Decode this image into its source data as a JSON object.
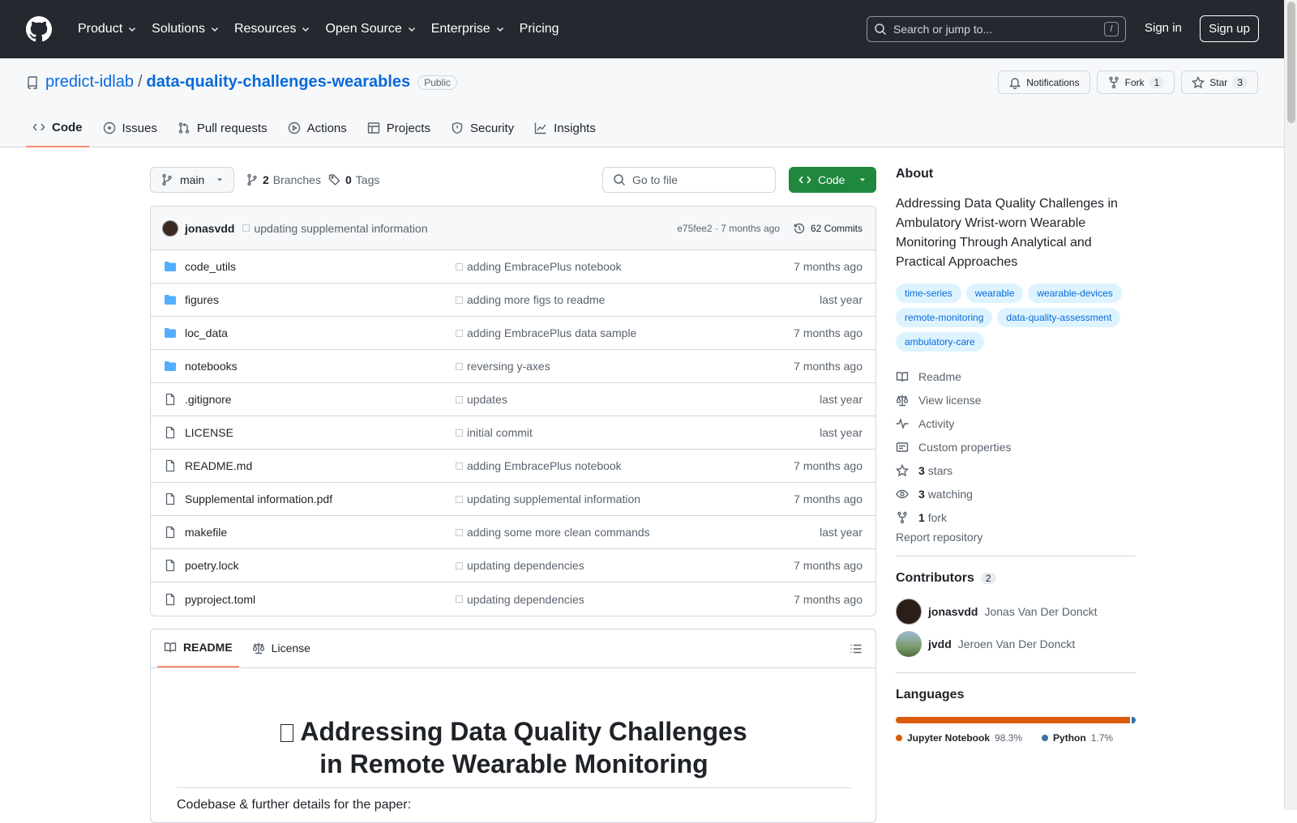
{
  "nav": {
    "items": [
      "Product",
      "Solutions",
      "Resources",
      "Open Source",
      "Enterprise",
      "Pricing"
    ],
    "search_placeholder": "Search or jump to...",
    "search_key": "/",
    "signin": "Sign in",
    "signup": "Sign up"
  },
  "repo": {
    "owner": "predict-idlab",
    "name": "data-quality-challenges-wearables",
    "visibility": "Public",
    "notifications_label": "Notifications",
    "fork_label": "Fork",
    "fork_count": "1",
    "star_label": "Star",
    "star_count": "3"
  },
  "tabs": [
    {
      "label": "Code",
      "icon": "code-icon",
      "active": true
    },
    {
      "label": "Issues",
      "icon": "issue-icon"
    },
    {
      "label": "Pull requests",
      "icon": "pull-request-icon"
    },
    {
      "label": "Actions",
      "icon": "play-icon"
    },
    {
      "label": "Projects",
      "icon": "table-icon"
    },
    {
      "label": "Security",
      "icon": "shield-icon"
    },
    {
      "label": "Insights",
      "icon": "graph-icon"
    }
  ],
  "filebar": {
    "branch": "main",
    "branches_count": "2",
    "branches_label": "Branches",
    "tags_count": "0",
    "tags_label": "Tags",
    "goto_placeholder": "Go to file",
    "code_label": "Code"
  },
  "latest_commit": {
    "author": "jonasvdd",
    "message": "updating supplemental information",
    "hash_time": "e75fee2 · 7 months ago",
    "commits_label": "62 Commits"
  },
  "files": [
    {
      "name": "code_utils",
      "type": "dir",
      "message": "adding EmbracePlus notebook",
      "date": "7 months ago"
    },
    {
      "name": "figures",
      "type": "dir",
      "message": "adding more figs to readme",
      "date": "last year"
    },
    {
      "name": "loc_data",
      "type": "dir",
      "message": "adding EmbracePlus data sample",
      "date": "7 months ago"
    },
    {
      "name": "notebooks",
      "type": "dir",
      "message": "reversing y-axes",
      "date": "7 months ago"
    },
    {
      "name": ".gitignore",
      "type": "file",
      "message": "updates",
      "date": "last year"
    },
    {
      "name": "LICENSE",
      "type": "file",
      "message": "initial commit",
      "date": "last year"
    },
    {
      "name": "README.md",
      "type": "file",
      "message": "adding EmbracePlus notebook",
      "date": "7 months ago"
    },
    {
      "name": "Supplemental information.pdf",
      "type": "file",
      "message": "updating supplemental information",
      "date": "7 months ago"
    },
    {
      "name": "makefile",
      "type": "file",
      "message": "adding some more clean commands",
      "date": "last year"
    },
    {
      "name": "poetry.lock",
      "type": "file",
      "message": "updating dependencies",
      "date": "7 months ago"
    },
    {
      "name": "pyproject.toml",
      "type": "file",
      "message": "updating dependencies",
      "date": "7 months ago"
    }
  ],
  "readme": {
    "tab_readme": "README",
    "tab_license": "License",
    "title_line1": "Addressing Data Quality Challenges",
    "title_line2": "in Remote Wearable Monitoring",
    "intro": "Codebase & further details for the paper:"
  },
  "about": {
    "heading": "About",
    "description": "Addressing Data Quality Challenges in Ambulatory Wrist-worn Wearable Monitoring Through Analytical and Practical Approaches",
    "topics": [
      "time-series",
      "wearable",
      "wearable-devices",
      "remote-monitoring",
      "data-quality-assessment",
      "ambulatory-care"
    ],
    "readme": "Readme",
    "license": "View license",
    "activity": "Activity",
    "custom_properties": "Custom properties",
    "stars_count": "3",
    "stars_label": "stars",
    "watching_count": "3",
    "watching_label": "watching",
    "forks_count": "1",
    "forks_label": "fork",
    "report": "Report repository"
  },
  "contributors": {
    "heading": "Contributors",
    "count": "2",
    "list": [
      {
        "login": "jonasvdd",
        "name": "Jonas Van Der Donckt"
      },
      {
        "login": "jvdd",
        "name": "Jeroen Van Der Donckt"
      }
    ]
  },
  "languages": {
    "heading": "Languages",
    "list": [
      {
        "name": "Jupyter Notebook",
        "pct": "98.3%",
        "value": 98.3,
        "color": "#DA5B0B"
      },
      {
        "name": "Python",
        "pct": "1.7%",
        "value": 1.7,
        "color": "#3572A5"
      }
    ]
  }
}
